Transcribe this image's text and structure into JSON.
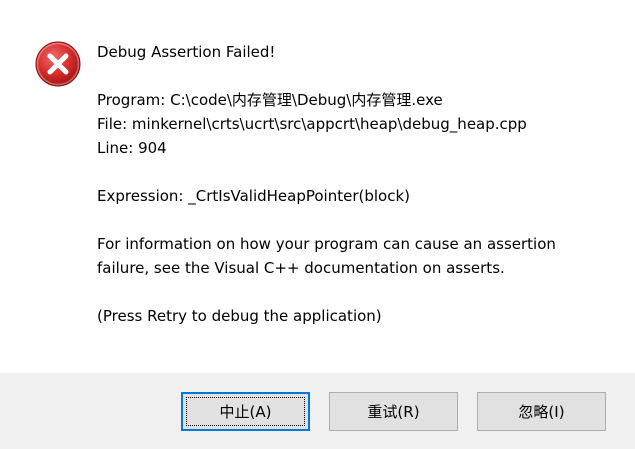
{
  "dialog": {
    "icon": "error-icon",
    "message_lines": [
      "Debug Assertion Failed!",
      "",
      "Program: C:\\code\\内存管理\\Debug\\内存管理.exe",
      "File: minkernel\\crts\\ucrt\\src\\appcrt\\heap\\debug_heap.cpp",
      "Line: 904",
      "",
      "Expression: _CrtIsValidHeapPointer(block)",
      "",
      "For information on how your program can cause an assertion",
      "failure, see the Visual C++ documentation on asserts.",
      "",
      "(Press Retry to debug the application)"
    ]
  },
  "buttons": {
    "abort_label": "中止(A)",
    "retry_label": "重试(R)",
    "ignore_label": "忽略(I)"
  },
  "colors": {
    "icon_red": "#d42b2b",
    "focus_border": "#0078d7",
    "footer_bg": "#f0f0f0",
    "button_bg": "#e1e1e1"
  }
}
